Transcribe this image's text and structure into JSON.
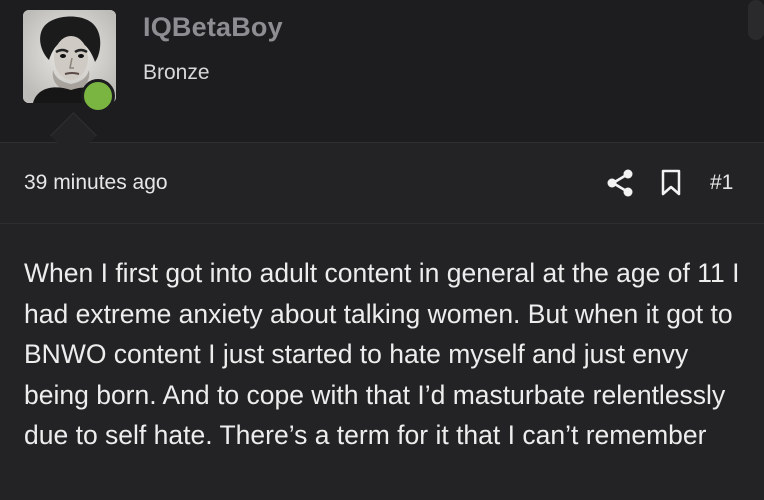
{
  "author": {
    "username": "IQBetaBoy",
    "rank": "Bronze",
    "avatar_icon": "portrait-avatar",
    "status_color": "#7ab541",
    "status": "online"
  },
  "post": {
    "timestamp": "39 minutes ago",
    "share_icon": "share-icon",
    "bookmark_icon": "bookmark-icon",
    "post_number": "#1",
    "body": "When I first got into adult content in general at the age of 11 I had extreme anxiety about talking women. But when it got to BNWO content I just started to hate myself and just envy being born. And to cope with that I’d masturbate relentlessly due to self hate. There’s a term for it that I can’t remember"
  },
  "colors": {
    "background": "#1d1d1f",
    "post_background": "#232325",
    "username": "#8e8e92",
    "text": "#ededed"
  }
}
